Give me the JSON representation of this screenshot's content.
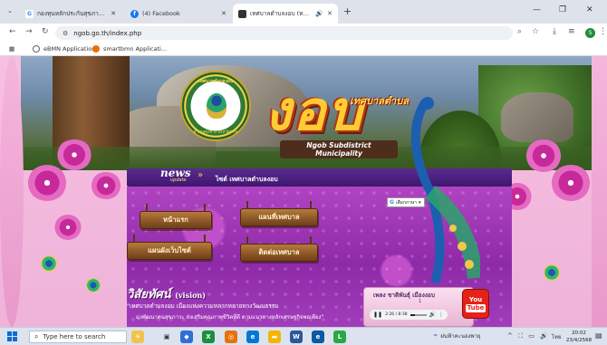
{
  "browser": {
    "tabs": [
      {
        "title": "กองทุนหลักประกันสุขภาพตำบลงอบ สำ...",
        "favicon_color": "#4285f4",
        "favicon_glyph": "G",
        "active": false
      },
      {
        "title": "(4) Facebook",
        "favicon_color": "#1877f2",
        "favicon_glyph": "f",
        "active": false
      },
      {
        "title": "เทศบาลตำบลงอบ (ทต.งอบ) อำ...",
        "favicon_color": "#333333",
        "favicon_glyph": "▦",
        "active": true
      }
    ],
    "new_tab": "+",
    "address": "ngob.go.th/index.php",
    "bookmarks": [
      {
        "label": "eBMN Application",
        "icon": "globe-icon",
        "color": "#5f6368"
      },
      {
        "label": "smartbmn Applicati...",
        "icon": "smartbmn-icon",
        "color": "#e8710a"
      }
    ],
    "profile_initial": "S"
  },
  "site": {
    "seal_text_top": "เทศบาลตำบลงอบ",
    "seal_text_bottom": "อำเภอทุ่งช้าง จังหวัดน่าน",
    "logo_small": "เทศบาลตำบล",
    "logo_big": "งอบ",
    "logo_english": "Ngob Subdistrict Municipality",
    "news_badge": "news",
    "news_sub": "update",
    "news_text": "ไซต์ เทศบาลตำบลงอบ",
    "translate_label": "เลือกภาษา",
    "menu_buttons": [
      {
        "label": "หน้าแรก"
      },
      {
        "label": "แผนที่เทศบาล"
      },
      {
        "label": "แผนผังเว็บไซต์"
      },
      {
        "label": "ติดต่อเทศบาล"
      }
    ],
    "vision_title": "วิสัยทัศน์",
    "vision_title_en": "(vision)",
    "vision_line1": "\"เทศบาลตำบลงอบ เมืองแห่งความหลากหลายทางวัฒนธรรม",
    "vision_line2": "มุ่งพัฒนาคนสุขภาวะ ส่งเสริมคุณภาพชีวิตที่ดี ตามแนวทางหลักเศรษฐกิจพอเพียง\"",
    "player": {
      "song": "เพลง ชาติพันธุ์ เมืองงอบ",
      "sub": "1",
      "time": "2:26 / 8:38",
      "progress": 0.28
    },
    "youtube_top": "You",
    "youtube_bottom": "Tube"
  },
  "taskbar": {
    "search_placeholder": "Type here to search",
    "weather": "ฝนฟ้าคะนองพายุ",
    "date": "23/4/2568",
    "time": "20:02",
    "lang": "ไทย"
  }
}
